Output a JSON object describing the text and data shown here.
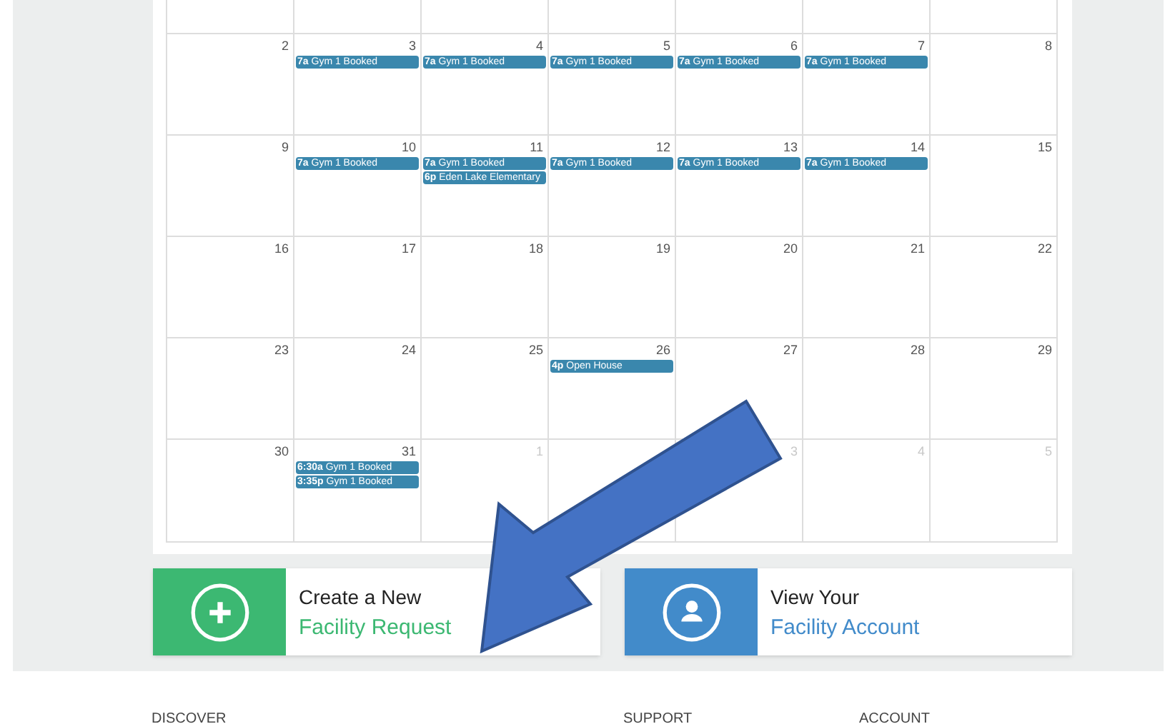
{
  "calendar": {
    "weeks": [
      {
        "days": [
          {
            "date": "2",
            "muted": false
          },
          {
            "date": "3",
            "muted": false,
            "events": [
              {
                "time": "7a",
                "title": "Gym 1 Booked"
              }
            ]
          },
          {
            "date": "4",
            "muted": false,
            "events": [
              {
                "time": "7a",
                "title": "Gym 1 Booked"
              }
            ]
          },
          {
            "date": "5",
            "muted": false,
            "events": [
              {
                "time": "7a",
                "title": "Gym 1 Booked"
              }
            ]
          },
          {
            "date": "6",
            "muted": false,
            "events": [
              {
                "time": "7a",
                "title": "Gym 1 Booked"
              }
            ]
          },
          {
            "date": "7",
            "muted": false,
            "events": [
              {
                "time": "7a",
                "title": "Gym 1 Booked"
              }
            ]
          },
          {
            "date": "8",
            "muted": false
          }
        ]
      },
      {
        "days": [
          {
            "date": "9",
            "muted": false
          },
          {
            "date": "10",
            "muted": false,
            "events": [
              {
                "time": "7a",
                "title": "Gym 1 Booked"
              }
            ]
          },
          {
            "date": "11",
            "muted": false,
            "events": [
              {
                "time": "7a",
                "title": "Gym 1 Booked"
              },
              {
                "time": "6p",
                "title": "Eden Lake Elementary"
              }
            ]
          },
          {
            "date": "12",
            "muted": false,
            "events": [
              {
                "time": "7a",
                "title": "Gym 1 Booked"
              }
            ]
          },
          {
            "date": "13",
            "muted": false,
            "events": [
              {
                "time": "7a",
                "title": "Gym 1 Booked"
              }
            ]
          },
          {
            "date": "14",
            "muted": false,
            "events": [
              {
                "time": "7a",
                "title": "Gym 1 Booked"
              }
            ]
          },
          {
            "date": "15",
            "muted": false
          }
        ]
      },
      {
        "days": [
          {
            "date": "16",
            "muted": false
          },
          {
            "date": "17",
            "muted": false
          },
          {
            "date": "18",
            "muted": false
          },
          {
            "date": "19",
            "muted": false
          },
          {
            "date": "20",
            "muted": false
          },
          {
            "date": "21",
            "muted": false
          },
          {
            "date": "22",
            "muted": false
          }
        ]
      },
      {
        "days": [
          {
            "date": "23",
            "muted": false
          },
          {
            "date": "24",
            "muted": false
          },
          {
            "date": "25",
            "muted": false
          },
          {
            "date": "26",
            "muted": false,
            "events": [
              {
                "time": "4p",
                "title": "Open House"
              }
            ]
          },
          {
            "date": "27",
            "muted": false
          },
          {
            "date": "28",
            "muted": false
          },
          {
            "date": "29",
            "muted": false
          }
        ]
      },
      {
        "days": [
          {
            "date": "30",
            "muted": false
          },
          {
            "date": "31",
            "muted": false,
            "events": [
              {
                "time": "6:30a",
                "title": "Gym 1 Booked"
              },
              {
                "time": "3:35p",
                "title": "Gym 1 Booked"
              }
            ]
          },
          {
            "date": "1",
            "muted": true
          },
          {
            "date": "3",
            "muted": true,
            "after_covered_day": true
          },
          {
            "date": "4",
            "muted": true
          },
          {
            "date": "5",
            "muted": true
          }
        ]
      }
    ]
  },
  "action_cards": [
    {
      "kind": "create",
      "line1": "Create a New",
      "line2": "Facility Request"
    },
    {
      "kind": "account",
      "line1": "View Your",
      "line2": "Facility Account"
    }
  ],
  "footer": {
    "headings": [
      "DISCOVER",
      "SUPPORT",
      "ACCOUNT"
    ]
  }
}
